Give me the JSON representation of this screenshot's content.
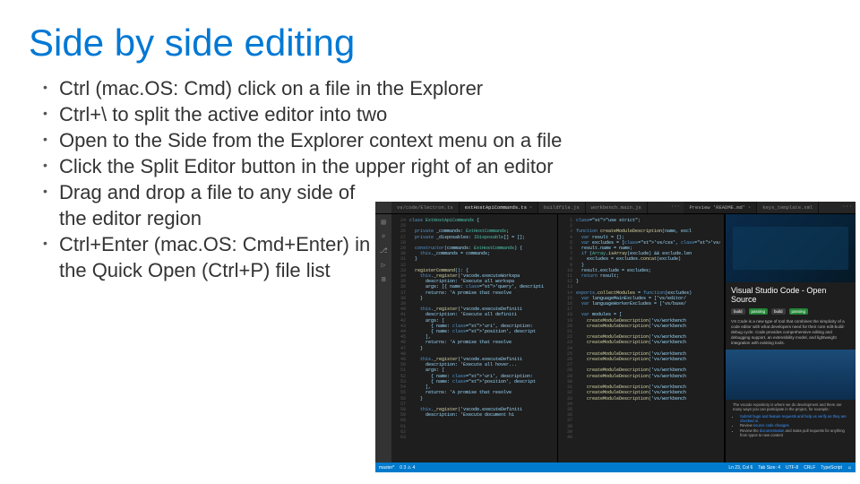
{
  "title": "Side by side editing",
  "bullets": [
    "Ctrl (mac.OS: Cmd) click on a file in the Explorer",
    "Ctrl+\\ to split the active editor into two",
    "Open to the Side from the Explorer context menu on a file",
    "Click the Split Editor button in the upper right of an editor",
    "Drag and drop a file to any side of the editor region",
    "Ctrl+Enter (mac.OS: Cmd+Enter) in the Quick Open (Ctrl+P) file list"
  ],
  "editor": {
    "tabs_row1": [
      "vs/code/Electron.ts"
    ],
    "tabs_row1_active": "extHostApiCommands.ts",
    "tabs_row2": [
      "buildfile.js",
      "workbench.main.js"
    ],
    "tabs_row3_title": "Preview 'README.md'",
    "tabs_row3_other": "keys_template.xml",
    "dots": "···",
    "gutter_start": 24,
    "gutter_count": 40,
    "code_left": "class ExtHostApiCommands {\n\n  private _commands: ExtHostCommands;\n  private _disposables: IDisposable[] = [];\n\n  constructor(commands: ExtHostCommands) {\n    this._commands = commands;\n  }\n\n  registerCommand(): {\n    this._register('vscode.executeWorkspa\n      description: 'Execute all workspa\n      args: [{ name: 'query', descripti\n      returns: 'A promise that resolve\n    }\n\n    this._register('vscode.executeDefiniti\n      description: 'Execute all definiti\n      args: [\n        { name: 'uri', description:\n        { name: 'position', descript\n      ],\n      returns: 'A promise that resolve\n    }\n\n    this._register('vscode.executeDefiniti\n      description: 'Execute all hover...\n      args: [\n        { name: 'uri', description:\n        { name: 'position', descript\n      ],\n      returns: 'A promise that resolve\n    }\n\n    this._register('vscode.executeDefiniti\n      description: 'Execute document hi\n",
    "code_right": "\"use strict\";\n\nfunction createModuleDescription(name, excl\n  var result = {};\n  var excludes = ['vs/css', 'vs/nls'];\n  result.name = name;\n  if (Array.isArray(exclude) && exclude.len\n    excludes = excludes.concat(exclude)\n  }\n  result.exclude = excludes;\n  return result;\n}\n\nexports.collectModules = function(excludes)\n  var languageMainExcludes = ['vs/editor/\n  var languageWorkerExcludes = ['vs/base/\n\n  var modules = [\n    createModuleDescription('vs/workbench\n    createModuleDescription('vs/workbench\n\n    createModuleDescription('vs/workbench\n    createModuleDescription('vs/workbench\n\n    createModuleDescription('vs/workbench\n    createModuleDescription('vs/workbench\n\n    createModuleDescription('vs/workbench\n    createModuleDescription('vs/workbench\n\n    createModuleDescription('vs/workbench\n    createModuleDescription('vs/workbench\n    createModuleDescription('vs/workbench\n",
    "preview": {
      "heading": "Visual Studio Code - Open Source",
      "badge1a": "build",
      "badge1b": "passing",
      "badge2a": "build",
      "badge2b": "passing",
      "p1": "VS Code is a new type of tool that combines the simplicity of a code editor with what developers need for their core edit-build-debug cycle. Code provides comprehensive editing and debugging support, an extensibility model, and lightweight integration with existing tools.",
      "p2": "The vscode repository is where we do development and there are many ways you can participate in the project, for example:",
      "li1": "Submit bugs and feature requests and help us verify as they are checked in.",
      "li2a": "Review ",
      "li2b": "source code changes",
      "li3a": "Review the ",
      "li3b": "documentation",
      "li3c": " and make pull requests for anything from typos to new content"
    },
    "status": {
      "left1": "master*",
      "left2": "0 3 ⚠ 4",
      "right1": "Ln 23, Col 6",
      "right2": "Tab Size: 4",
      "right3": "UTF-8",
      "right4": "CRLF",
      "right5": "TypeScript",
      "right6": "☺"
    }
  }
}
